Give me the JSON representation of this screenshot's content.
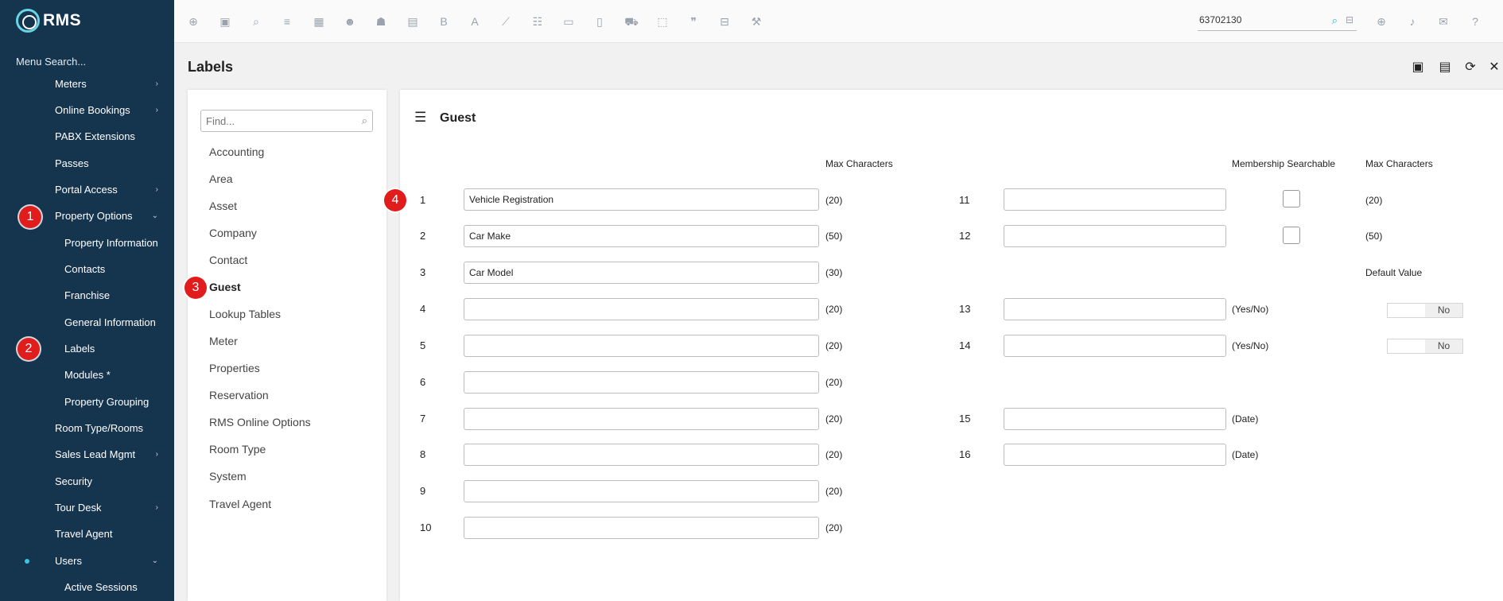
{
  "app": {
    "logo_text": "RMS"
  },
  "sidebar": {
    "menu_search": "Menu Search...",
    "items": [
      {
        "label": "Meters",
        "chevron": "›"
      },
      {
        "label": "Online Bookings",
        "chevron": "›"
      },
      {
        "label": "PABX Extensions",
        "chevron": ""
      },
      {
        "label": "Passes",
        "chevron": ""
      },
      {
        "label": "Portal Access",
        "chevron": "›"
      },
      {
        "label": "Property Options",
        "chevron": "⌄"
      },
      {
        "label": "Property Information",
        "chevron": ""
      },
      {
        "label": "Contacts",
        "chevron": ""
      },
      {
        "label": "Franchise",
        "chevron": ""
      },
      {
        "label": "General Information",
        "chevron": ""
      },
      {
        "label": "Labels",
        "chevron": ""
      },
      {
        "label": "Modules *",
        "chevron": ""
      },
      {
        "label": "Property Grouping",
        "chevron": ""
      },
      {
        "label": "Room Type/Rooms",
        "chevron": ""
      },
      {
        "label": "Sales Lead Mgmt",
        "chevron": "›"
      },
      {
        "label": "Security",
        "chevron": ""
      },
      {
        "label": "Tour Desk",
        "chevron": "›"
      },
      {
        "label": "Travel Agent",
        "chevron": ""
      },
      {
        "label": "Users",
        "chevron": "⌄"
      },
      {
        "label": "Active Sessions",
        "chevron": ""
      }
    ]
  },
  "badges": [
    "1",
    "2",
    "3",
    "4"
  ],
  "topbar": {
    "icons": [
      "add-icon",
      "calendar-icon",
      "search-icon",
      "sliders-icon",
      "grid-icon",
      "users-icon",
      "group-icon",
      "map-icon",
      "bold-b-icon",
      "letter-a-icon",
      "chart-icon",
      "checklist-icon",
      "card-icon",
      "document-icon",
      "cart-icon",
      "ticket-icon",
      "quote-icon",
      "bed-icon",
      "hammer-icon"
    ],
    "glyphs": [
      "⊕",
      "▣",
      "⌕",
      "≡",
      "▦",
      "☻",
      "☗",
      "▤",
      "B",
      "A",
      "⟋",
      "☷",
      "▭",
      "▯",
      "⛟",
      "⬚",
      "❞",
      "⊟",
      "⚒"
    ],
    "search_value": "63702130",
    "right_glyphs": [
      "⊕",
      "♪",
      "✉",
      "?"
    ]
  },
  "page": {
    "title": "Labels",
    "actions": [
      "▣",
      "▤",
      "⟳",
      "✕"
    ]
  },
  "list": {
    "find_placeholder": "Find...",
    "items": [
      "Accounting",
      "Area",
      "Asset",
      "Company",
      "Contact",
      "Guest",
      "Lookup Tables",
      "Meter",
      "Properties",
      "Reservation",
      "RMS Online Options",
      "Room Type",
      "System",
      "Travel Agent"
    ],
    "active": "Guest"
  },
  "main": {
    "section_title": "Guest",
    "hdr_max_characters": "Max Characters",
    "hdr_membership_searchable": "Membership Searchable",
    "hdr_max_characters_2": "Max Characters",
    "hdr_default_value": "Default Value",
    "left_rows": [
      {
        "num": "1",
        "value": "Vehicle Registration",
        "max": "(20)"
      },
      {
        "num": "2",
        "value": "Car Make",
        "max": "(50)"
      },
      {
        "num": "3",
        "value": "Car Model",
        "max": "(30)"
      },
      {
        "num": "4",
        "value": "",
        "max": "(20)"
      },
      {
        "num": "5",
        "value": "",
        "max": "(20)"
      },
      {
        "num": "6",
        "value": "",
        "max": "(20)"
      },
      {
        "num": "7",
        "value": "",
        "max": "(20)"
      },
      {
        "num": "8",
        "value": "",
        "max": "(20)"
      },
      {
        "num": "9",
        "value": "",
        "max": "(20)"
      },
      {
        "num": "10",
        "value": "",
        "max": "(20)"
      }
    ],
    "right_rows": [
      {
        "num": "11",
        "value": "",
        "type": "",
        "max": "(20)"
      },
      {
        "num": "12",
        "value": "",
        "type": "",
        "max": "(50)"
      },
      {
        "num": "13",
        "value": "",
        "type": "(Yes/No)",
        "default": "No"
      },
      {
        "num": "14",
        "value": "",
        "type": "(Yes/No)",
        "default": "No"
      },
      {
        "num": "15",
        "value": "",
        "type": "(Date)"
      },
      {
        "num": "16",
        "value": "",
        "type": "(Date)"
      }
    ]
  }
}
